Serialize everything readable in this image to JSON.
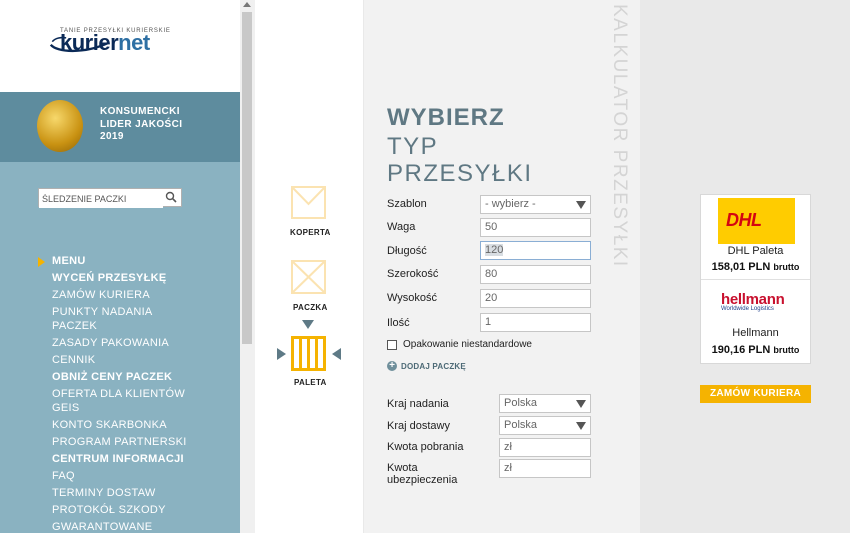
{
  "logo": {
    "tagline": "TANIE PRZESYŁKI KURIERSKIE",
    "brand_a": "kurier",
    "brand_b": "net"
  },
  "award": {
    "line1": "KONSUMENCKI",
    "line2": "LIDER JAKOŚCI",
    "line3": "2019"
  },
  "search": {
    "placeholder": "ŚLEDZENIE PACZKI"
  },
  "menu": {
    "items": [
      {
        "label": "MENU",
        "bold": true
      },
      {
        "label": "WYCEŃ PRZESYŁKĘ",
        "bold": true
      },
      {
        "label": "ZAMÓW KURIERA",
        "bold": false
      },
      {
        "label": "PUNKTY NADANIA",
        "bold": false
      },
      {
        "label": "PACZEK",
        "bold": false
      },
      {
        "label": "ZASADY PAKOWANIA",
        "bold": false
      },
      {
        "label": "CENNIK",
        "bold": false
      },
      {
        "label": "OBNIŻ CENY PACZEK",
        "bold": true
      },
      {
        "label": "OFERTA DLA KLIENTÓW",
        "bold": false
      },
      {
        "label": "GEIS",
        "bold": false
      },
      {
        "label": "KONTO SKARBONKA",
        "bold": false
      },
      {
        "label": "PROGRAM PARTNERSKI",
        "bold": false
      },
      {
        "label": "CENTRUM INFORMACJI",
        "bold": true
      },
      {
        "label": "FAQ",
        "bold": false
      },
      {
        "label": "TERMINY DOSTAW",
        "bold": false
      },
      {
        "label": "PROTOKÓŁ SZKODY",
        "bold": false
      },
      {
        "label": "GWARANTOWANE",
        "bold": false
      }
    ]
  },
  "types": {
    "envelope": "KOPERTA",
    "package": "PACZKA",
    "pallet": "PALETA",
    "selected": "PALETA"
  },
  "calculator": {
    "vertical_title": "KALKULATOR PRZESYŁKI",
    "heading1": "WYBIERZ",
    "heading2": "TYP",
    "heading3": "PRZESYŁKI",
    "template_label": "Szablon",
    "template_value": "- wybierz -",
    "weight_label": "Waga",
    "weight_value": "50",
    "length_label": "Długość",
    "length_value": "120",
    "width_label": "Szerokość",
    "width_value": "80",
    "height_label": "Wysokość",
    "height_value": "20",
    "qty_label": "Ilość",
    "qty_value": "1",
    "nonstandard_label": "Opakowanie niestandardowe",
    "add_package_label": "DODAJ PACZKĘ",
    "country_from_label": "Kraj nadania",
    "country_from_value": "Polska",
    "country_to_label": "Kraj dostawy",
    "country_to_value": "Polska",
    "cod_label": "Kwota pobrania",
    "cod_placeholder": "zł",
    "insurance_label_1": "Kwota",
    "insurance_label_2": "ubezpieczenia",
    "insurance_placeholder": "zł"
  },
  "results": [
    {
      "logo_text": "DHL",
      "name": "DHL Paleta",
      "price": "158,01 PLN",
      "unit": "brutto"
    },
    {
      "logo_text": "hellmann",
      "logo_sub": "Worldwide Logistics",
      "name": "Hellmann",
      "price": "190,16 PLN",
      "unit": "brutto"
    }
  ],
  "order_button": "ZAMÓW KURIERA",
  "colors": {
    "sidebar": "#8ab2c1",
    "accent": "#f5b301",
    "heading": "#5f7883"
  }
}
